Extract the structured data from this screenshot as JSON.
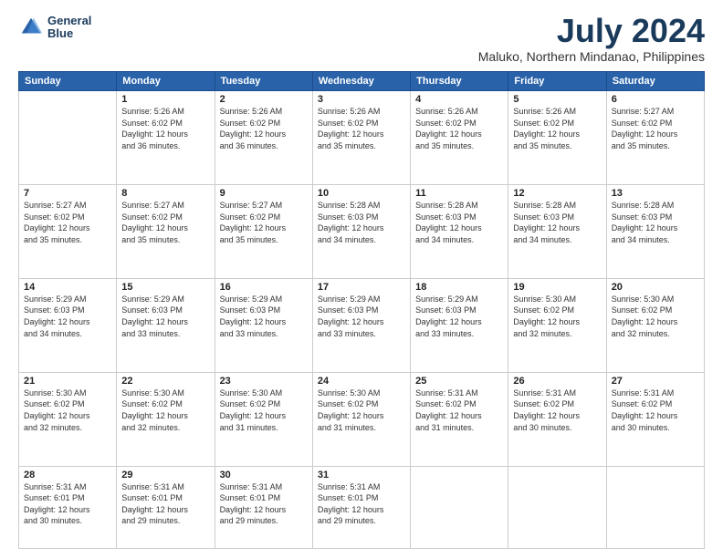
{
  "logo": {
    "line1": "General",
    "line2": "Blue"
  },
  "title": "July 2024",
  "subtitle": "Maluko, Northern Mindanao, Philippines",
  "weekdays": [
    "Sunday",
    "Monday",
    "Tuesday",
    "Wednesday",
    "Thursday",
    "Friday",
    "Saturday"
  ],
  "weeks": [
    [
      {
        "day": "",
        "info": ""
      },
      {
        "day": "1",
        "info": "Sunrise: 5:26 AM\nSunset: 6:02 PM\nDaylight: 12 hours\nand 36 minutes."
      },
      {
        "day": "2",
        "info": "Sunrise: 5:26 AM\nSunset: 6:02 PM\nDaylight: 12 hours\nand 36 minutes."
      },
      {
        "day": "3",
        "info": "Sunrise: 5:26 AM\nSunset: 6:02 PM\nDaylight: 12 hours\nand 35 minutes."
      },
      {
        "day": "4",
        "info": "Sunrise: 5:26 AM\nSunset: 6:02 PM\nDaylight: 12 hours\nand 35 minutes."
      },
      {
        "day": "5",
        "info": "Sunrise: 5:26 AM\nSunset: 6:02 PM\nDaylight: 12 hours\nand 35 minutes."
      },
      {
        "day": "6",
        "info": "Sunrise: 5:27 AM\nSunset: 6:02 PM\nDaylight: 12 hours\nand 35 minutes."
      }
    ],
    [
      {
        "day": "7",
        "info": "Sunrise: 5:27 AM\nSunset: 6:02 PM\nDaylight: 12 hours\nand 35 minutes."
      },
      {
        "day": "8",
        "info": "Sunrise: 5:27 AM\nSunset: 6:02 PM\nDaylight: 12 hours\nand 35 minutes."
      },
      {
        "day": "9",
        "info": "Sunrise: 5:27 AM\nSunset: 6:02 PM\nDaylight: 12 hours\nand 35 minutes."
      },
      {
        "day": "10",
        "info": "Sunrise: 5:28 AM\nSunset: 6:03 PM\nDaylight: 12 hours\nand 34 minutes."
      },
      {
        "day": "11",
        "info": "Sunrise: 5:28 AM\nSunset: 6:03 PM\nDaylight: 12 hours\nand 34 minutes."
      },
      {
        "day": "12",
        "info": "Sunrise: 5:28 AM\nSunset: 6:03 PM\nDaylight: 12 hours\nand 34 minutes."
      },
      {
        "day": "13",
        "info": "Sunrise: 5:28 AM\nSunset: 6:03 PM\nDaylight: 12 hours\nand 34 minutes."
      }
    ],
    [
      {
        "day": "14",
        "info": "Sunrise: 5:29 AM\nSunset: 6:03 PM\nDaylight: 12 hours\nand 34 minutes."
      },
      {
        "day": "15",
        "info": "Sunrise: 5:29 AM\nSunset: 6:03 PM\nDaylight: 12 hours\nand 33 minutes."
      },
      {
        "day": "16",
        "info": "Sunrise: 5:29 AM\nSunset: 6:03 PM\nDaylight: 12 hours\nand 33 minutes."
      },
      {
        "day": "17",
        "info": "Sunrise: 5:29 AM\nSunset: 6:03 PM\nDaylight: 12 hours\nand 33 minutes."
      },
      {
        "day": "18",
        "info": "Sunrise: 5:29 AM\nSunset: 6:03 PM\nDaylight: 12 hours\nand 33 minutes."
      },
      {
        "day": "19",
        "info": "Sunrise: 5:30 AM\nSunset: 6:02 PM\nDaylight: 12 hours\nand 32 minutes."
      },
      {
        "day": "20",
        "info": "Sunrise: 5:30 AM\nSunset: 6:02 PM\nDaylight: 12 hours\nand 32 minutes."
      }
    ],
    [
      {
        "day": "21",
        "info": "Sunrise: 5:30 AM\nSunset: 6:02 PM\nDaylight: 12 hours\nand 32 minutes."
      },
      {
        "day": "22",
        "info": "Sunrise: 5:30 AM\nSunset: 6:02 PM\nDaylight: 12 hours\nand 32 minutes."
      },
      {
        "day": "23",
        "info": "Sunrise: 5:30 AM\nSunset: 6:02 PM\nDaylight: 12 hours\nand 31 minutes."
      },
      {
        "day": "24",
        "info": "Sunrise: 5:30 AM\nSunset: 6:02 PM\nDaylight: 12 hours\nand 31 minutes."
      },
      {
        "day": "25",
        "info": "Sunrise: 5:31 AM\nSunset: 6:02 PM\nDaylight: 12 hours\nand 31 minutes."
      },
      {
        "day": "26",
        "info": "Sunrise: 5:31 AM\nSunset: 6:02 PM\nDaylight: 12 hours\nand 30 minutes."
      },
      {
        "day": "27",
        "info": "Sunrise: 5:31 AM\nSunset: 6:02 PM\nDaylight: 12 hours\nand 30 minutes."
      }
    ],
    [
      {
        "day": "28",
        "info": "Sunrise: 5:31 AM\nSunset: 6:01 PM\nDaylight: 12 hours\nand 30 minutes."
      },
      {
        "day": "29",
        "info": "Sunrise: 5:31 AM\nSunset: 6:01 PM\nDaylight: 12 hours\nand 29 minutes."
      },
      {
        "day": "30",
        "info": "Sunrise: 5:31 AM\nSunset: 6:01 PM\nDaylight: 12 hours\nand 29 minutes."
      },
      {
        "day": "31",
        "info": "Sunrise: 5:31 AM\nSunset: 6:01 PM\nDaylight: 12 hours\nand 29 minutes."
      },
      {
        "day": "",
        "info": ""
      },
      {
        "day": "",
        "info": ""
      },
      {
        "day": "",
        "info": ""
      }
    ]
  ]
}
